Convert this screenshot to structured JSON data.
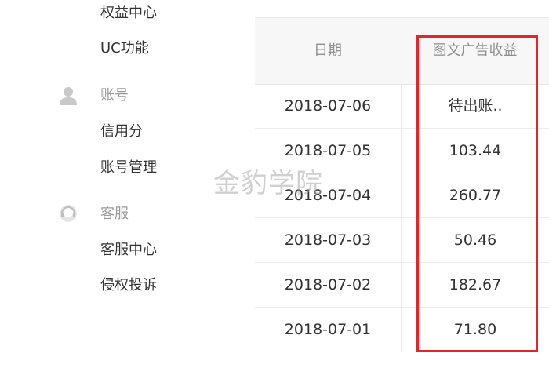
{
  "sidebar": {
    "items_top": [
      {
        "label": "权益中心"
      },
      {
        "label": "UC功能"
      }
    ],
    "groups": [
      {
        "title": "账号",
        "icon": "user-icon",
        "items": [
          {
            "label": "信用分"
          },
          {
            "label": "账号管理"
          }
        ]
      },
      {
        "title": "客服",
        "icon": "customer-service-icon",
        "items": [
          {
            "label": "客服中心"
          },
          {
            "label": "侵权投诉"
          }
        ]
      }
    ]
  },
  "table": {
    "headers": {
      "date": "日期",
      "revenue": "图文广告收益"
    },
    "rows": [
      {
        "date": "2018-07-06",
        "revenue": "待出账.."
      },
      {
        "date": "2018-07-05",
        "revenue": "103.44"
      },
      {
        "date": "2018-07-04",
        "revenue": "260.77"
      },
      {
        "date": "2018-07-03",
        "revenue": "50.46"
      },
      {
        "date": "2018-07-02",
        "revenue": "182.67"
      },
      {
        "date": "2018-07-01",
        "revenue": "71.80"
      }
    ]
  },
  "watermark": "金豹学院",
  "colors": {
    "highlight": "#e2262b",
    "header_bg": "#f7f7f7"
  }
}
